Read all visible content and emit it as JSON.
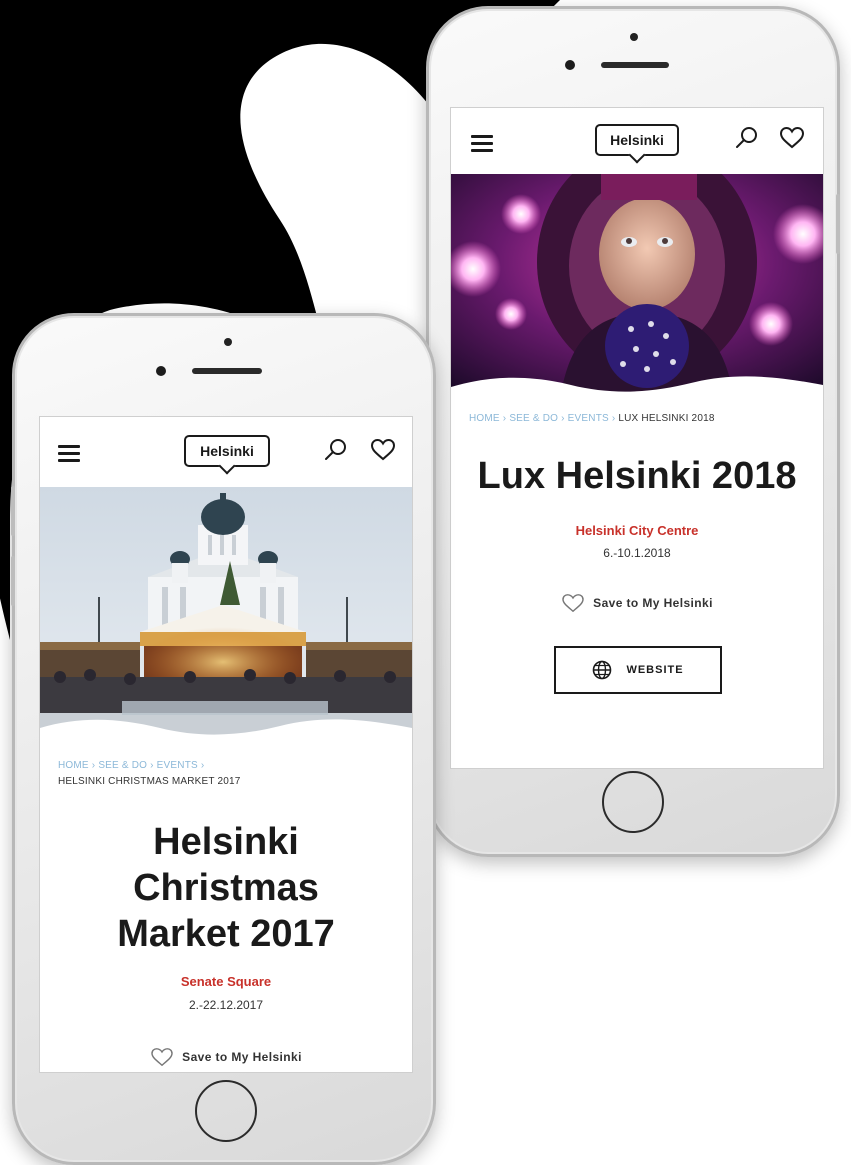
{
  "colors": {
    "accent": "#c8312a",
    "breadcrumb_link": "#8cb8d8",
    "text": "#1a1a1a"
  },
  "back_phone": {
    "header": {
      "logo_text": "Helsinki",
      "menu_icon": "hamburger-icon",
      "search_icon": "search-icon",
      "favorite_icon": "heart-icon"
    },
    "breadcrumb": {
      "home": "HOME",
      "sep": "›",
      "see_do": "SEE & DO",
      "events": "EVENTS",
      "current": "LUX HELSINKI 2018"
    },
    "title": "Lux Helsinki 2018",
    "location": "Helsinki City Centre",
    "date": "6.-10.1.2018",
    "save_label": "Save to My Helsinki",
    "website_label": "WEBSITE"
  },
  "front_phone": {
    "header": {
      "logo_text": "Helsinki",
      "menu_icon": "hamburger-icon",
      "search_icon": "search-icon",
      "favorite_icon": "heart-icon"
    },
    "breadcrumb": {
      "home": "HOME",
      "sep": "›",
      "see_do": "SEE & DO",
      "events": "EVENTS",
      "current": "HELSINKI CHRISTMAS MARKET 2017"
    },
    "title_lines": [
      "Helsinki",
      "Christmas",
      "Market 2017"
    ],
    "location": "Senate Square",
    "date": "2.-22.12.2017",
    "save_label": "Save to My Helsinki"
  }
}
